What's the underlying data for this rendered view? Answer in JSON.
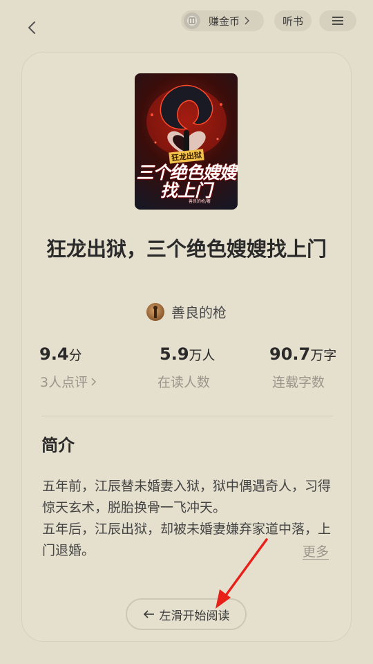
{
  "header": {
    "earn_coins_label": "赚金币",
    "listen_label": "听书"
  },
  "book": {
    "cover": {
      "tag": "狂龙出狱",
      "title_line1": "三个绝色嫂嫂",
      "title_line2": "找上门",
      "author_small": "善良的枪/著"
    },
    "title": "狂龙出狱，三个绝色嫂嫂找上门",
    "author": "善良的枪"
  },
  "stats": [
    {
      "value": "9.4",
      "unit": "分",
      "label": "3人点评"
    },
    {
      "value": "5.9",
      "unit": "万人",
      "label": "在读人数"
    },
    {
      "value": "90.7",
      "unit": "万字",
      "label": "连载字数"
    }
  ],
  "intro": {
    "heading": "简介",
    "paragraph1": "五年前，江辰替未婚妻入狱，狱中偶遇奇人，习得惊天玄术，脱胎换骨一飞冲天。",
    "paragraph2": "五年后，江辰出狱，却被未婚妻嫌弃家道中落，上门退婚。",
    "more_label": "更多"
  },
  "start_button": {
    "label": "左滑开始阅读"
  },
  "colors": {
    "background": "#e3ddcb",
    "annotation_arrow": "#e8201a"
  }
}
